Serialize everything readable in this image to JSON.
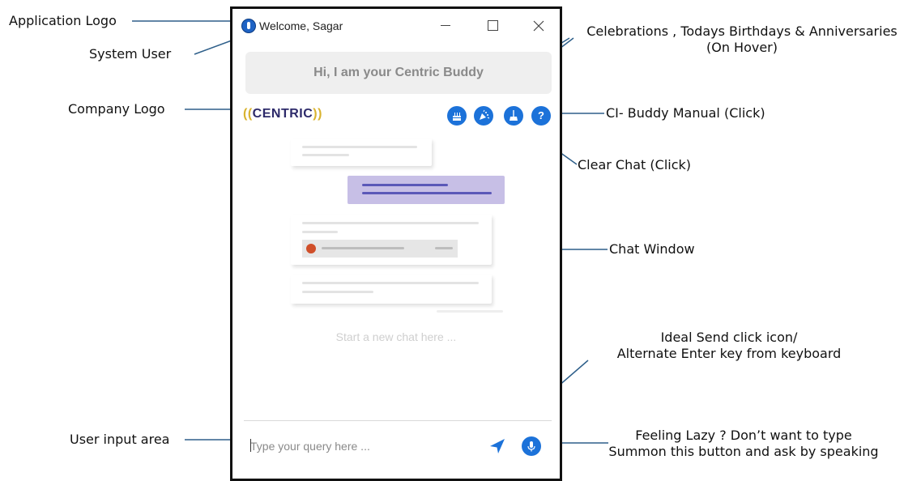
{
  "window": {
    "welcome_text": "Welcome, Sagar",
    "minimize_icon": "minimize-icon",
    "maximize_icon": "maximize-icon",
    "close_icon": "close-icon"
  },
  "chat": {
    "greeting": "Hi, I am your Centric Buddy",
    "company_logo_text": "CENTRIC",
    "company_logo_paren_left": "((",
    "company_logo_paren_right": "))",
    "toolbar_icons": [
      "birthday-cake-icon",
      "party-popper-icon",
      "broom-icon",
      "help-icon"
    ],
    "help_glyph": "?",
    "new_chat_hint": "Start a new chat here ...",
    "input_placeholder": "Type your query here ..."
  },
  "annotations": {
    "app_logo": "Application Logo",
    "system_user": "System User",
    "company_logo": "Company Logo",
    "celebrations_line1": "Celebrations , Todays Birthdays & Anniversaries",
    "celebrations_line2": "(On Hover)",
    "manual": "CI- Buddy Manual (Click)",
    "clear_chat": "Clear Chat (Click)",
    "chat_window": "Chat Window",
    "send_line1": "Ideal Send click icon/",
    "send_line2": "Alternate Enter key from keyboard",
    "user_input": "User input area",
    "lazy_line1": "Feeling Lazy ? Don’t want to type",
    "lazy_line2": "Summon this button and ask by speaking"
  },
  "colors": {
    "accent_blue": "#1c72d9",
    "user_bubble": "#c7bfe6",
    "annotation_line": "#2e5f8a",
    "logo_gold": "#d9b32f",
    "logo_navy": "#2d2a6a"
  }
}
